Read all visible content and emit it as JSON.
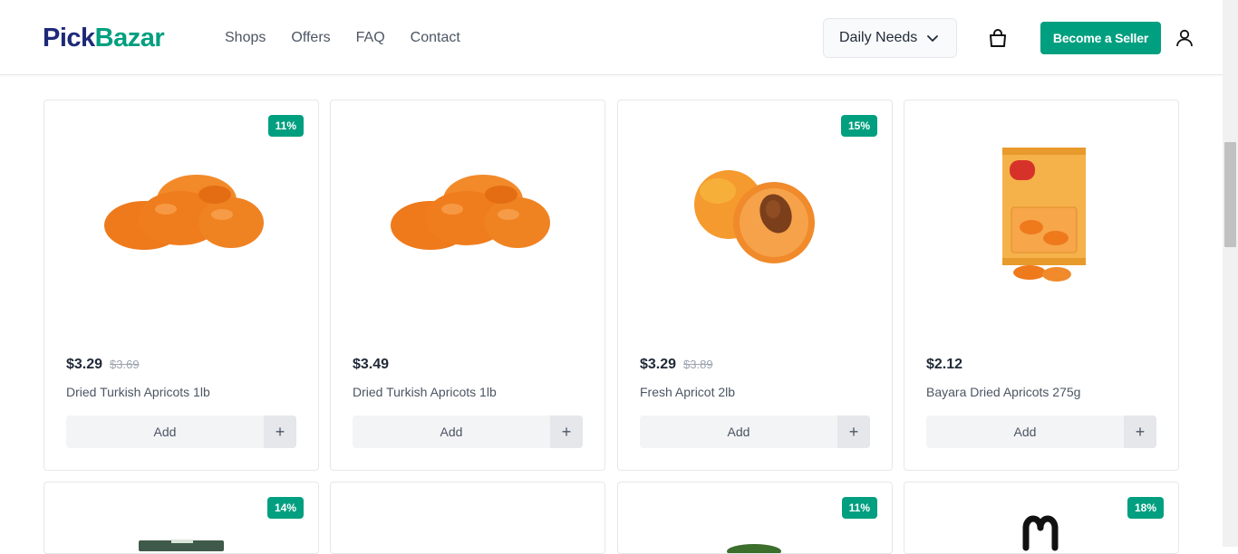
{
  "brand": {
    "part1": "Pick",
    "part2": "Bazar"
  },
  "nav": [
    "Shops",
    "Offers",
    "FAQ",
    "Contact"
  ],
  "category_select": {
    "selected": "Daily Needs"
  },
  "seller_button": "Become a Seller",
  "colors": {
    "accent": "#009f7f",
    "logo_dark": "#1e2a78"
  },
  "products": [
    {
      "badge": "11%",
      "price": "$3.29",
      "old_price": "$3.69",
      "name": "Dried Turkish Apricots 1lb",
      "add": "Add",
      "plus": "+",
      "image": "dried-apricots"
    },
    {
      "badge": "",
      "price": "$3.49",
      "old_price": "",
      "name": "Dried Turkish Apricots 1lb",
      "add": "Add",
      "plus": "+",
      "image": "dried-apricots"
    },
    {
      "badge": "15%",
      "price": "$3.29",
      "old_price": "$3.89",
      "name": "Fresh Apricot 2lb",
      "add": "Add",
      "plus": "+",
      "image": "fresh-apricot"
    },
    {
      "badge": "",
      "price": "$2.12",
      "old_price": "",
      "name": "Bayara Dried Apricots 275g",
      "add": "Add",
      "plus": "+",
      "image": "apricot-package"
    }
  ],
  "next_row_badges": [
    "14%",
    "",
    "11%",
    "18%"
  ]
}
